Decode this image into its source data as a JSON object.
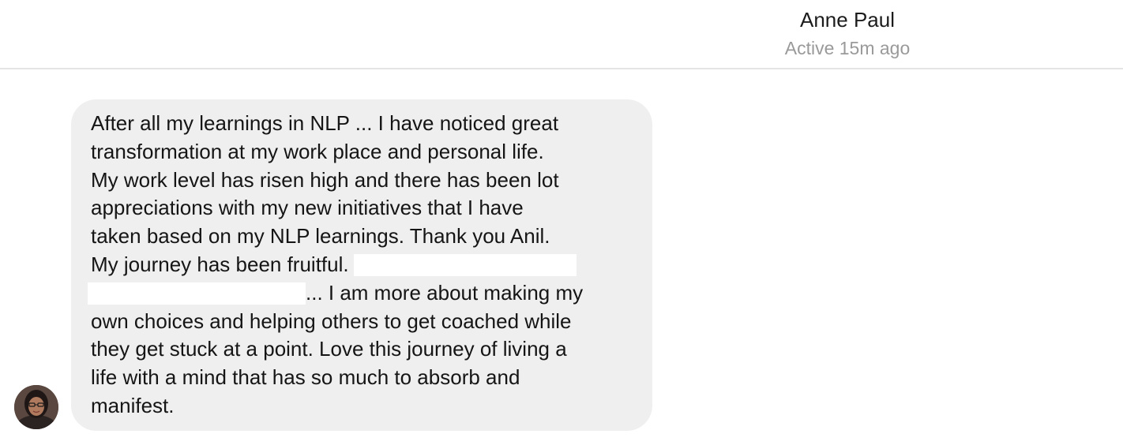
{
  "header": {
    "contact_name": "Anne Paul",
    "status": "Active 15m ago"
  },
  "avatar": {
    "icon": "profile-photo"
  },
  "message": {
    "line1": "After all my learnings in NLP ... I have noticed great",
    "line2": "transformation at my work place and personal life.",
    "line3": "My work level has risen high and there has been lot",
    "line4": "appreciations with my new initiatives that I have",
    "line5": "taken based on my NLP learnings. Thank you Anil.",
    "line6": "My journey has been fruitful.",
    "line7": "... I am more about making my",
    "line8": "own choices and helping others to get coached while",
    "line9": "they get stuck at a point. Love this journey of living a",
    "line10": "life with a mind that has so much to absorb and",
    "line11": "manifest."
  },
  "colors": {
    "bubble": "#efefef",
    "divider": "#e4e4e4",
    "status_text": "#9a9a9a",
    "redaction": "#ffffff"
  }
}
